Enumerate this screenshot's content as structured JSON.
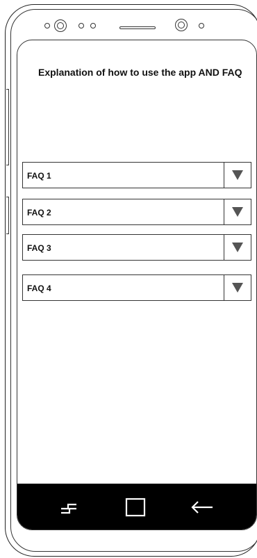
{
  "intro": {
    "text": "Explanation of how to use the app AND FAQ"
  },
  "faq": {
    "items": [
      {
        "label": "FAQ 1"
      },
      {
        "label": "FAQ 2"
      },
      {
        "label": "FAQ 3"
      },
      {
        "label": "FAQ 4"
      }
    ]
  },
  "nav": {
    "icons": [
      "recent-apps-icon",
      "home-icon",
      "back-icon"
    ]
  },
  "colors": {
    "outline": "#333333",
    "nav_bar": "#000000",
    "arrow": "#555555"
  }
}
